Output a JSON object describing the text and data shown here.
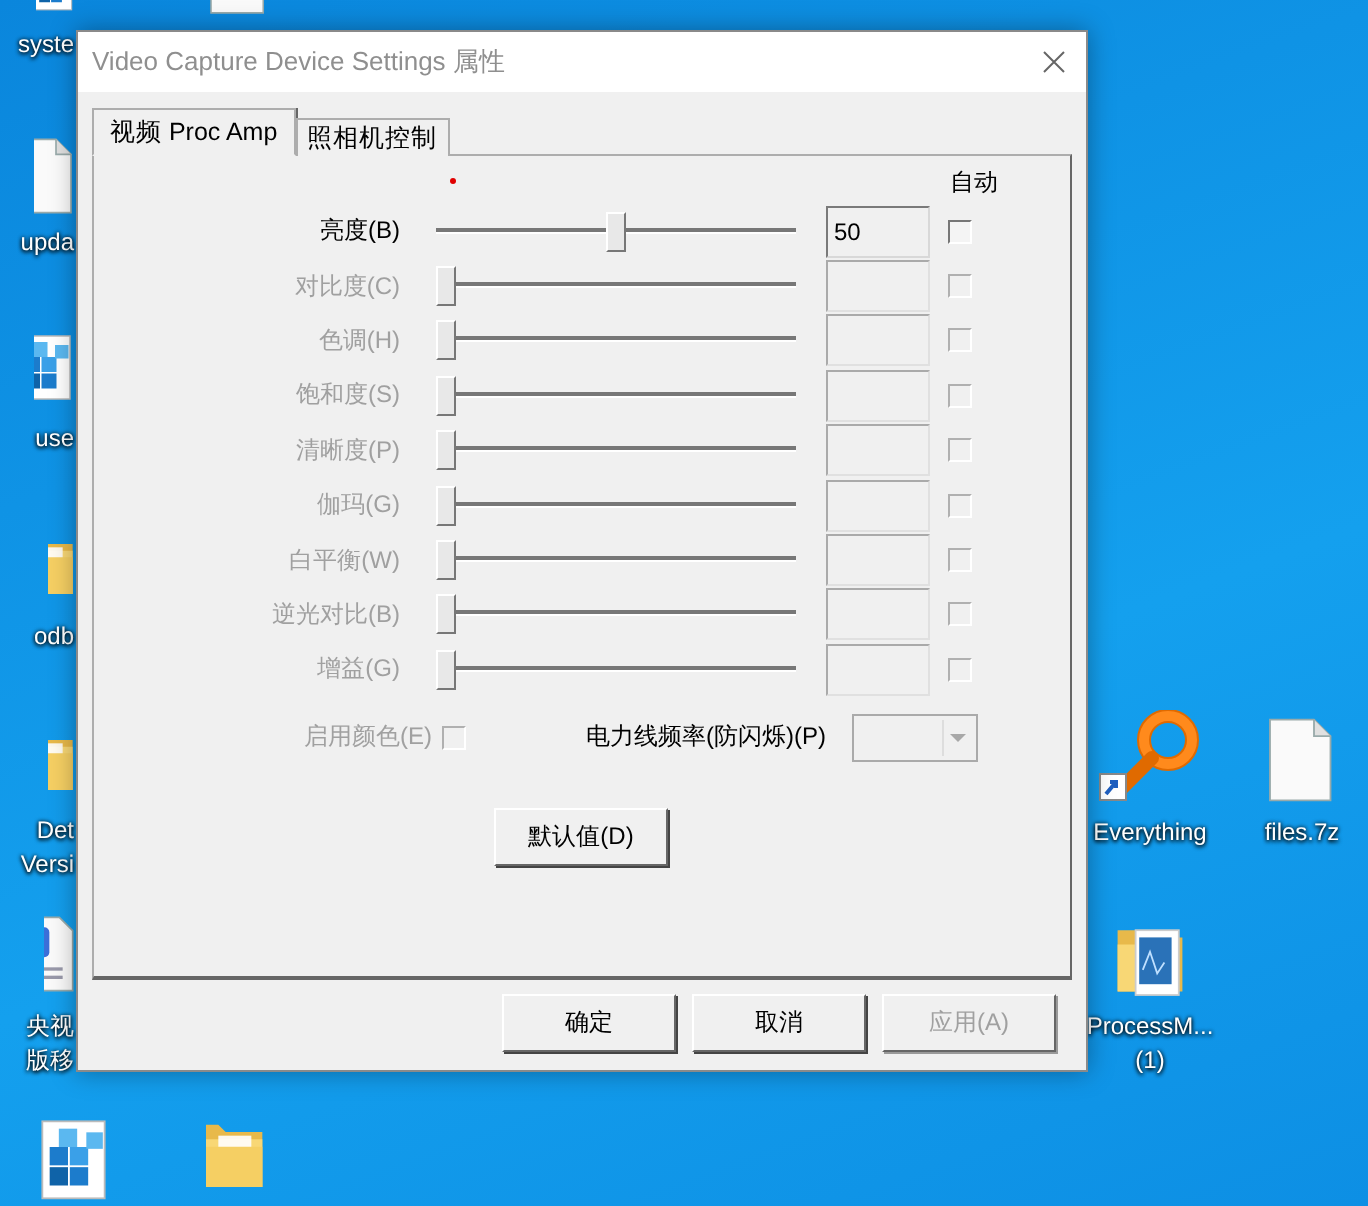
{
  "desktop": {
    "icons": [
      {
        "kind": "cube",
        "lines": [
          "syste"
        ]
      },
      {
        "kind": "page",
        "lines": [
          "upda"
        ]
      },
      {
        "kind": "cube",
        "lines": [
          "use"
        ]
      },
      {
        "kind": "folder",
        "lines": [
          "odb"
        ]
      },
      {
        "kind": "folder",
        "lines": [
          "Det",
          "Versi"
        ]
      },
      {
        "kind": "word",
        "lines": [
          "央视",
          "版移"
        ]
      },
      {
        "kind": "page"
      },
      {
        "kind": "cube"
      },
      {
        "kind": "folder"
      },
      {
        "kind": "magnifier",
        "lines": [
          "Everything"
        ]
      },
      {
        "kind": "page",
        "lines": [
          "files.7z"
        ]
      },
      {
        "kind": "chartfolder",
        "lines": [
          "ProcessM...",
          "(1)"
        ]
      }
    ]
  },
  "dialog": {
    "title": "Video Capture Device Settings 属性",
    "tabs": [
      {
        "label": "视频 Proc Amp",
        "selected": true
      },
      {
        "label": "照相机控制",
        "selected": false
      }
    ],
    "auto_header": "自动",
    "controls": [
      {
        "label": "亮度(B)",
        "disabled": false,
        "level": 0.5,
        "value": "50",
        "auto": false
      },
      {
        "label": "对比度(C)",
        "disabled": true,
        "level": 0,
        "auto": false
      },
      {
        "label": "色调(H)",
        "disabled": true,
        "level": 0,
        "auto": false
      },
      {
        "label": "饱和度(S)",
        "disabled": true,
        "level": 0,
        "auto": false
      },
      {
        "label": "清晰度(P)",
        "disabled": true,
        "level": 0,
        "auto": false
      },
      {
        "label": "伽玛(G)",
        "disabled": true,
        "level": 0,
        "auto": false
      },
      {
        "label": "白平衡(W)",
        "disabled": true,
        "level": 0,
        "auto": false
      },
      {
        "label": "逆光对比(B)",
        "disabled": true,
        "level": 0,
        "auto": false
      },
      {
        "label": "增益(G)",
        "disabled": true,
        "level": 0,
        "auto": false
      }
    ],
    "enable_color": {
      "label": "启用颜色(E)",
      "checked": false,
      "disabled": true
    },
    "power_line": {
      "label": "电力线频率(防闪烁)(P)",
      "disabled": true
    },
    "default_button": {
      "label": "默认值(D)"
    },
    "buttons": [
      {
        "label": "确定",
        "disabled": false
      },
      {
        "label": "取消",
        "disabled": false
      },
      {
        "label": "应用(A)",
        "disabled": true
      }
    ]
  }
}
